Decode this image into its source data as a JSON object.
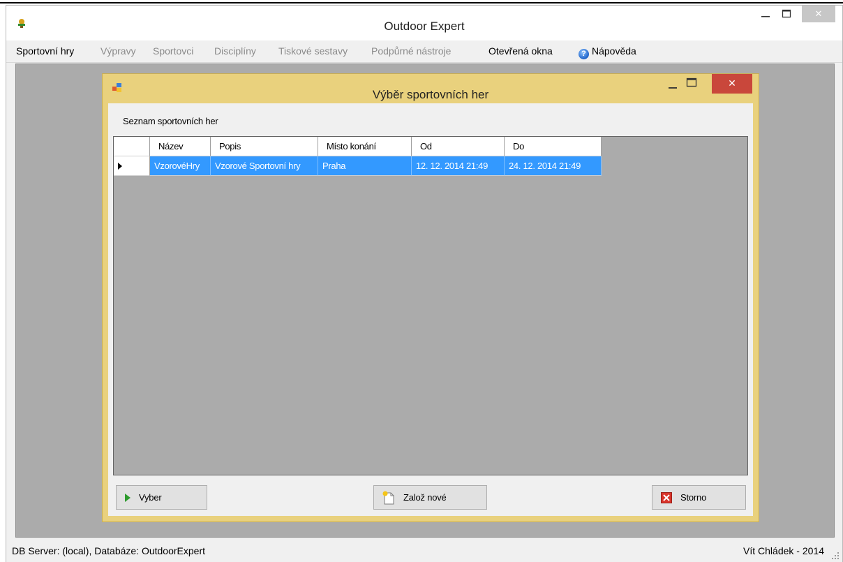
{
  "window": {
    "title": "Outdoor Expert",
    "minimize_glyph": "—",
    "maximize_glyph": "☐",
    "close_glyph": "✕"
  },
  "menu": [
    {
      "label": "Sportovní hry",
      "active": true
    },
    {
      "label": "Výpravy",
      "active": false
    },
    {
      "label": "Sportovci",
      "active": false
    },
    {
      "label": "Disciplíny",
      "active": false
    },
    {
      "label": "Tiskové sestavy",
      "active": false
    },
    {
      "label": "Podpůrné nástroje",
      "active": false
    },
    {
      "label": "Otevřená okna",
      "active": true
    },
    {
      "label": "Nápověda",
      "active": true,
      "icon": "help-icon"
    }
  ],
  "dialog": {
    "title": "Výběr sportovních her",
    "close_glyph": "✕",
    "grid_label": "Seznam sportovních her",
    "grid": {
      "columns": [
        "Název",
        "Popis",
        "Místo konání",
        "Od",
        "Do"
      ],
      "rows": [
        {
          "selected": true,
          "cells": [
            "VzorovéHry",
            "Vzorové Sportovní hry",
            "Praha",
            "12. 12. 2014 21:49",
            "24. 12. 2014 21:49"
          ]
        }
      ]
    },
    "buttons": {
      "select": "Vyber",
      "new": "Založ nové",
      "cancel": "Storno"
    }
  },
  "status": {
    "left": "DB Server: (local), Databáze: OutdoorExpert",
    "right": "Vít Chládek - 2014"
  },
  "colors": {
    "dialog_frame": "#e9d17d",
    "selection": "#3399ff",
    "close_button": "#c9473b",
    "mdi_background": "#ababab"
  }
}
